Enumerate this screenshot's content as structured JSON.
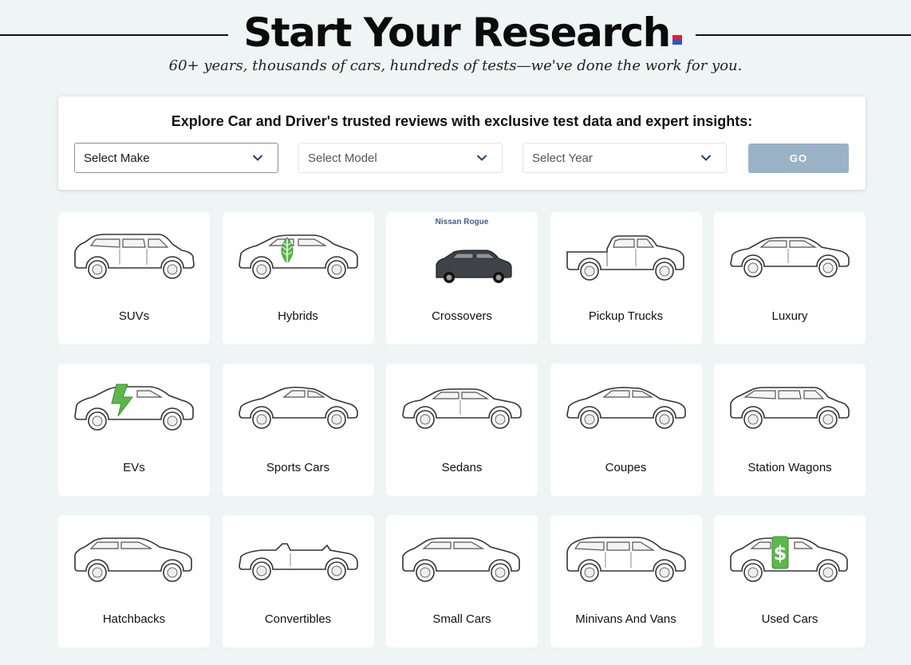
{
  "header": {
    "title": "Start Your Research",
    "subtitle": "60+ years, thousands of cars, hundreds of tests—we've done the work for you.",
    "accent_colors": [
      "#d6243a",
      "#2b55c4"
    ]
  },
  "search": {
    "heading": "Explore Car and Driver's trusted reviews with exclusive test data and expert insights:",
    "make_label": "Select Make",
    "model_label": "Select Model",
    "year_label": "Select Year",
    "go_label": "GO",
    "go_color": "#99b2c6"
  },
  "categories": [
    {
      "label": "SUVs",
      "icon": "suv-icon"
    },
    {
      "label": "Hybrids",
      "icon": "hybrid-leaf-car-icon"
    },
    {
      "label": "Crossovers",
      "icon": "crossover-photo",
      "tag": "Nissan Rogue"
    },
    {
      "label": "Pickup Trucks",
      "icon": "pickup-truck-icon"
    },
    {
      "label": "Luxury",
      "icon": "luxury-sedan-icon"
    },
    {
      "label": "EVs",
      "icon": "ev-lightning-car-icon"
    },
    {
      "label": "Sports Cars",
      "icon": "sports-car-icon"
    },
    {
      "label": "Sedans",
      "icon": "sedan-icon"
    },
    {
      "label": "Coupes",
      "icon": "coupe-icon"
    },
    {
      "label": "Station Wagons",
      "icon": "station-wagon-icon"
    },
    {
      "label": "Hatchbacks",
      "icon": "hatchback-icon"
    },
    {
      "label": "Convertibles",
      "icon": "convertible-icon"
    },
    {
      "label": "Small Cars",
      "icon": "small-car-icon"
    },
    {
      "label": "Minivans And Vans",
      "icon": "minivan-icon"
    },
    {
      "label": "Used Cars",
      "icon": "used-car-dollar-icon"
    }
  ]
}
